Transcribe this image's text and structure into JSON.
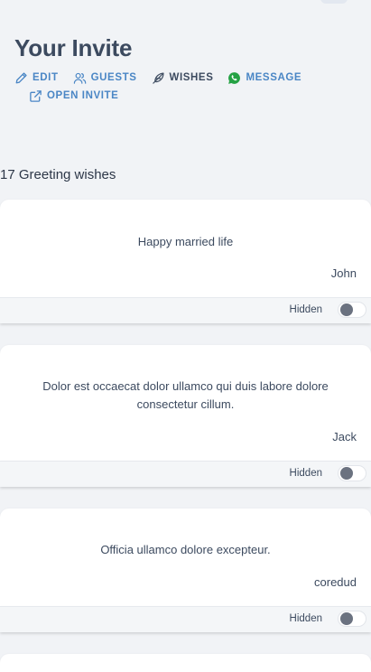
{
  "page": {
    "title": "Your Invite"
  },
  "actions": [
    {
      "label": "EDIT",
      "icon": "pencil-icon",
      "color": "#4a86c5"
    },
    {
      "label": "GUESTS",
      "icon": "users-icon",
      "color": "#4a86c5"
    },
    {
      "label": "WISHES",
      "icon": "feather-icon",
      "color": "#3c4a5f",
      "active": true
    },
    {
      "label": "MESSAGE",
      "icon": "whatsapp-icon",
      "color": "#4a86c5"
    },
    {
      "label": "OPEN INVITE",
      "icon": "external-link-icon",
      "color": "#4a86c5"
    }
  ],
  "wishes": {
    "count_label": "17 Greeting wishes",
    "items": [
      {
        "message": "Happy married life",
        "author": "John",
        "status_label": "Hidden",
        "visible": false
      },
      {
        "message": "Dolor est occaecat dolor ullamco qui duis labore dolore consectetur cillum.",
        "author": "Jack",
        "status_label": "Hidden",
        "visible": false
      },
      {
        "message": "Officia ullamco dolore excepteur.",
        "author": "coredud",
        "status_label": "Hidden",
        "visible": false
      }
    ]
  },
  "colors": {
    "accent": "#4a86c5",
    "heading": "#3c4a5f",
    "whatsapp": "#25a244",
    "toggle_knob_off": "#6b7280",
    "background": "#f1f3f6"
  }
}
